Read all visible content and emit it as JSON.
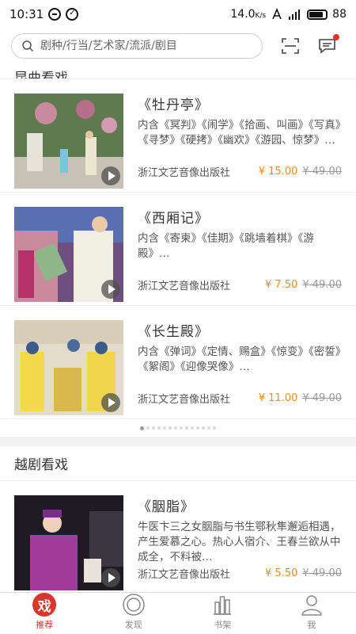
{
  "status": {
    "time": "10:31",
    "speed": "14.0",
    "speed_unit": "K/s",
    "battery": "88"
  },
  "search": {
    "placeholder": "剧种/行当/艺术家/流派/剧目"
  },
  "sections": [
    {
      "title": "昆曲看戏",
      "items": [
        {
          "title": "《牡丹亭》",
          "desc": "内含《冥判》《闹学》《拾画、叫画》《写真》《寻梦》《硬拷》《幽欢》《游园、惊梦》…",
          "publisher": "浙江文艺音像出版社",
          "price": "¥ 15.00",
          "orig_price": "¥ 49.00"
        },
        {
          "title": "《西厢记》",
          "desc": "内含《寄柬》《佳期》《跳墙着棋》《游殿》…",
          "publisher": "浙江文艺音像出版社",
          "price": "¥ 7.50",
          "orig_price": "¥ 49.00"
        },
        {
          "title": "《长生殿》",
          "desc": "内含《弹词》《定情、赐盒》《惊变》《密誓》《絮阁》《迎像哭像》…",
          "publisher": "浙江文艺音像出版社",
          "price": "¥ 11.00",
          "orig_price": "¥ 49.00"
        }
      ],
      "pager_total": 14,
      "pager_active": 0
    },
    {
      "title": "越剧看戏",
      "items": [
        {
          "title": "《胭脂》",
          "desc": "牛医卞三之女胭脂与书生鄂秋隼邂逅相遇，产生爱慕之心。热心人宿介、王春兰欲从中成全，不料被…",
          "publisher": "浙江文艺音像出版社",
          "price": "¥ 5.50",
          "orig_price": "¥ 49.00"
        }
      ]
    }
  ],
  "nav": [
    {
      "label": "推荐",
      "icon": "xi-icon",
      "glyph": "戏",
      "active": true
    },
    {
      "label": "发现",
      "icon": "discover-icon",
      "active": false
    },
    {
      "label": "书架",
      "icon": "bookshelf-icon",
      "active": false
    },
    {
      "label": "我",
      "icon": "profile-icon",
      "active": false
    }
  ],
  "colors": {
    "accent": "#d9372b",
    "price": "#f08a1c"
  }
}
